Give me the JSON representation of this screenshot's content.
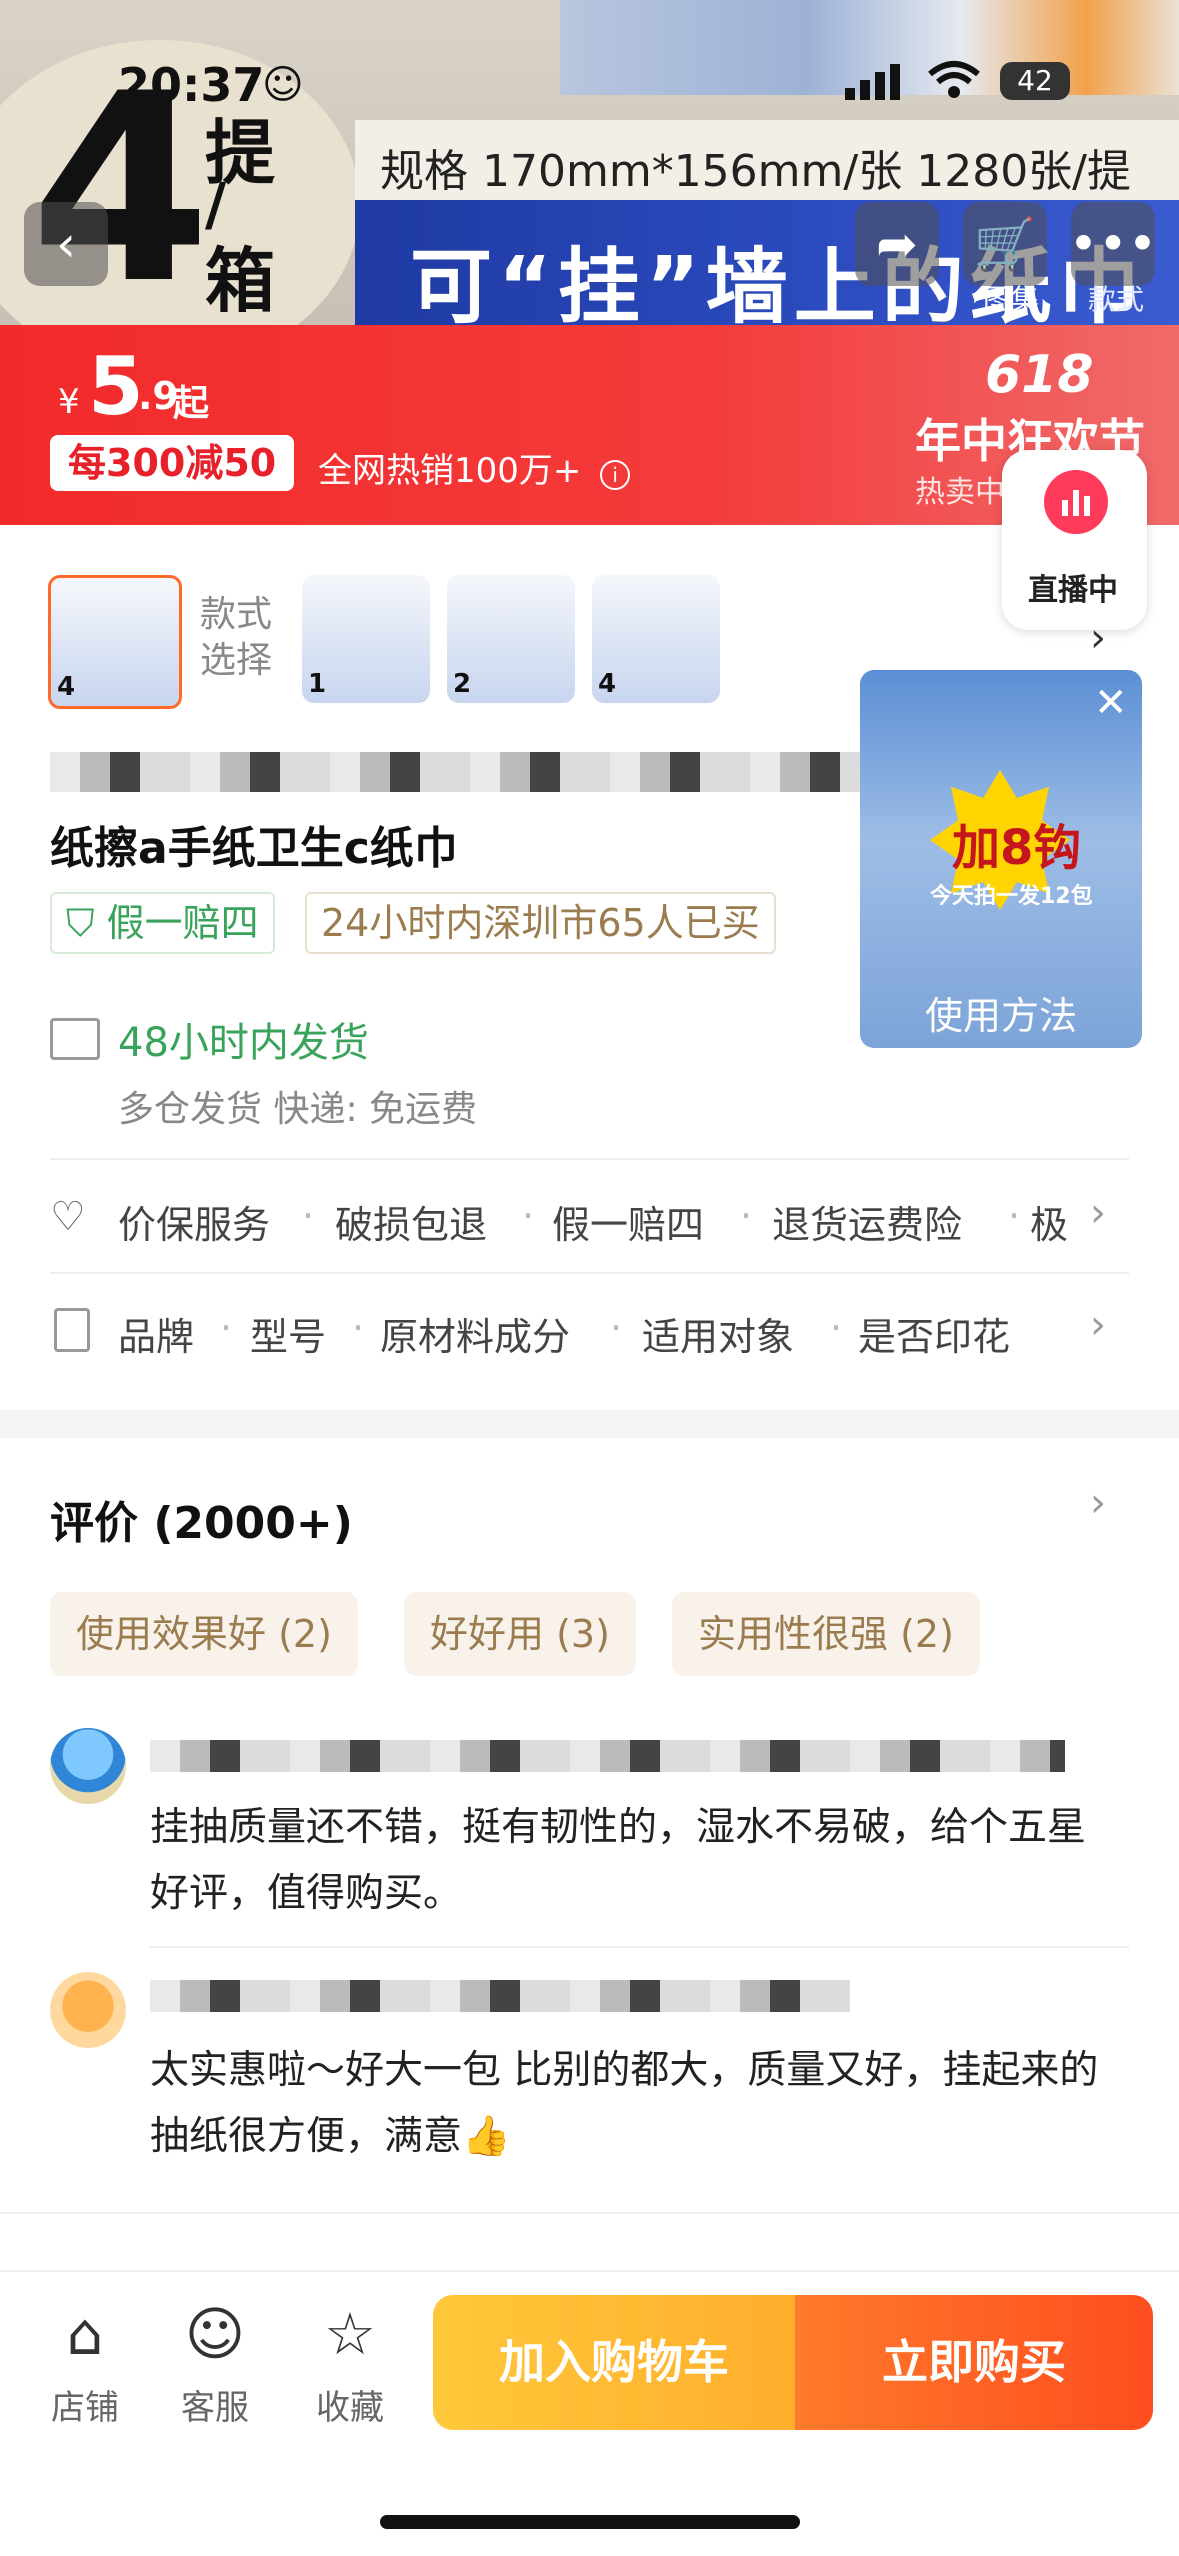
{
  "status_bar": {
    "time": "20:37",
    "battery": "42"
  },
  "hero": {
    "big_number": "4",
    "unit_top": "提",
    "unit_mid": "/",
    "unit_bottom": "箱",
    "spec": "规格 170mm*156mm/张  1280张/提",
    "slogan": "可“挂”墙上的纸巾",
    "buttons": {
      "gallery": "图集",
      "styles": "款式"
    }
  },
  "price": {
    "currency": "¥",
    "integer": "5",
    "decimal": ".9",
    "suffix": "起",
    "coupon": "每300减50",
    "hot_sale": "全网热销100万+",
    "festival_number": "618",
    "festival_title": "年中狂欢节",
    "festival_sub": "热卖中下单立抢"
  },
  "live_badge": {
    "label": "直播中"
  },
  "style_select": {
    "label": "款式选择",
    "thumbs": [
      "4",
      "1",
      "2",
      "4"
    ]
  },
  "video": {
    "badge": "加8钩",
    "sub": "今天拍一发12包",
    "label": "使用方法"
  },
  "product": {
    "title": "纸擦a手纸卫生c纸巾",
    "tag_guarantee": "假一赔四",
    "tag_bought": "24小时内深圳市65人已买"
  },
  "shipping": {
    "title": "48小时内发货",
    "detail": "多仓发货  快递: 免运费"
  },
  "services": {
    "items": [
      "价保服务",
      "破损包退",
      "假一赔四",
      "退货运费险",
      "极"
    ]
  },
  "params": {
    "items": [
      "品牌",
      "型号",
      "原材料成分",
      "适用对象",
      "是否印花"
    ]
  },
  "reviews": {
    "title": "评价 (2000+)",
    "chips": [
      "使用效果好 (2)",
      "好好用 (3)",
      "实用性很强 (2)"
    ],
    "items": [
      {
        "text": "挂抽质量还不错，挺有韧性的，湿水不易破，给个五星好评，值得购买。"
      },
      {
        "text": "太实惠啦～好大一包 比别的都大，质量又好，挂起来的抽纸很方便，满意👍"
      }
    ]
  },
  "bottom_bar": {
    "shop": "店铺",
    "service": "客服",
    "favorite": "收藏",
    "add_cart": "加入购物车",
    "buy_now": "立即购买"
  }
}
